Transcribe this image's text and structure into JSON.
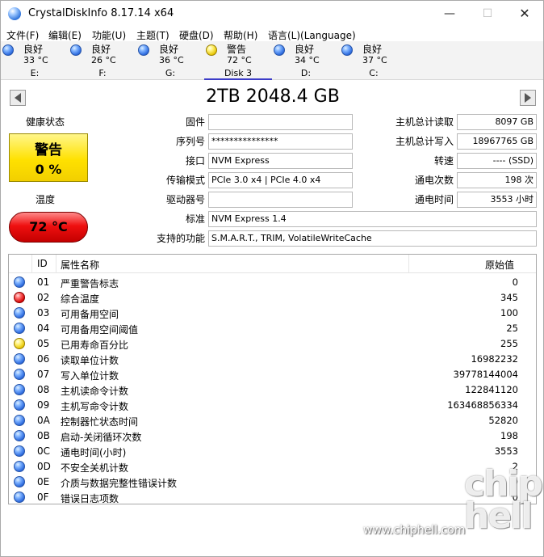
{
  "window": {
    "title": "CrystalDiskInfo 8.17.14 x64",
    "min_label": "—",
    "max_label": "☐",
    "close_label": "✕"
  },
  "menu": [
    "文件(F)",
    "编辑(E)",
    "功能(U)",
    "主题(T)",
    "硬盘(D)",
    "帮助(H)",
    "语言(L)(Language)"
  ],
  "disks": [
    {
      "status": "良好",
      "temp": "33 °C",
      "drive": "E:",
      "color": "blue"
    },
    {
      "status": "良好",
      "temp": "26 °C",
      "drive": "F:",
      "color": "blue"
    },
    {
      "status": "良好",
      "temp": "36 °C",
      "drive": "G:",
      "color": "blue"
    },
    {
      "status": "警告",
      "temp": "72 °C",
      "drive": "Disk 3",
      "color": "yellow",
      "active": true
    },
    {
      "status": "良好",
      "temp": "34 °C",
      "drive": "D:",
      "color": "blue"
    },
    {
      "status": "良好",
      "temp": "37 °C",
      "drive": "C:",
      "color": "blue"
    }
  ],
  "drive_title": "2TB 2048.4 GB",
  "health": {
    "label": "健康状态",
    "status": "警告",
    "percent": "0 %",
    "color": "#ffe100"
  },
  "temperature": {
    "label": "温度",
    "value": "72 °C",
    "color": "#e00000"
  },
  "fields": {
    "firmware": {
      "label": "固件",
      "value": ""
    },
    "serial": {
      "label": "序列号",
      "value": "***************"
    },
    "interface": {
      "label": "接口",
      "value": "NVM Express"
    },
    "transfer_mode": {
      "label": "传输模式",
      "value": "PCIe 3.0 x4 | PCIe 4.0 x4"
    },
    "drive_letter": {
      "label": "驱动器号",
      "value": ""
    },
    "standard": {
      "label": "标准",
      "value": "NVM Express 1.4"
    },
    "features": {
      "label": "支持的功能",
      "value": "S.M.A.R.T., TRIM, VolatileWriteCache"
    },
    "host_reads": {
      "label": "主机总计读取",
      "value": "8097 GB"
    },
    "host_writes": {
      "label": "主机总计写入",
      "value": "18967765 GB"
    },
    "rotation": {
      "label": "转速",
      "value": "---- (SSD)"
    },
    "power_count": {
      "label": "通电次数",
      "value": "198 次"
    },
    "power_hours": {
      "label": "通电时间",
      "value": "3553 小时"
    }
  },
  "smart": {
    "headers": {
      "id": "ID",
      "name": "属性名称",
      "raw": "原始值"
    },
    "rows": [
      {
        "id": "01",
        "name": "严重警告标志",
        "raw": "0",
        "color": "blue"
      },
      {
        "id": "02",
        "name": "综合温度",
        "raw": "345",
        "color": "red"
      },
      {
        "id": "03",
        "name": "可用备用空间",
        "raw": "100",
        "color": "blue"
      },
      {
        "id": "04",
        "name": "可用备用空间阈值",
        "raw": "25",
        "color": "blue"
      },
      {
        "id": "05",
        "name": "已用寿命百分比",
        "raw": "255",
        "color": "yellow"
      },
      {
        "id": "06",
        "name": "读取单位计数",
        "raw": "16982232",
        "color": "blue"
      },
      {
        "id": "07",
        "name": "写入单位计数",
        "raw": "39778144004",
        "color": "blue"
      },
      {
        "id": "08",
        "name": "主机读命令计数",
        "raw": "122841120",
        "color": "blue"
      },
      {
        "id": "09",
        "name": "主机写命令计数",
        "raw": "163468856334",
        "color": "blue"
      },
      {
        "id": "0A",
        "name": "控制器忙状态时间",
        "raw": "52820",
        "color": "blue"
      },
      {
        "id": "0B",
        "name": "启动-关闭循环次数",
        "raw": "198",
        "color": "blue"
      },
      {
        "id": "0C",
        "name": "通电时间(小时)",
        "raw": "3553",
        "color": "blue"
      },
      {
        "id": "0D",
        "name": "不安全关机计数",
        "raw": "2",
        "color": "blue"
      },
      {
        "id": "0E",
        "name": "介质与数据完整性错误计数",
        "raw": "0",
        "color": "blue"
      },
      {
        "id": "0F",
        "name": "错误日志项数",
        "raw": "0",
        "color": "blue"
      }
    ]
  },
  "watermark": {
    "logo": "chip hell",
    "url": "www.chiphell.com"
  },
  "icons": {
    "app": "crystaldiskinfo-icon",
    "prev": "prev-disk-arrow-icon",
    "next": "next-disk-arrow-icon"
  }
}
